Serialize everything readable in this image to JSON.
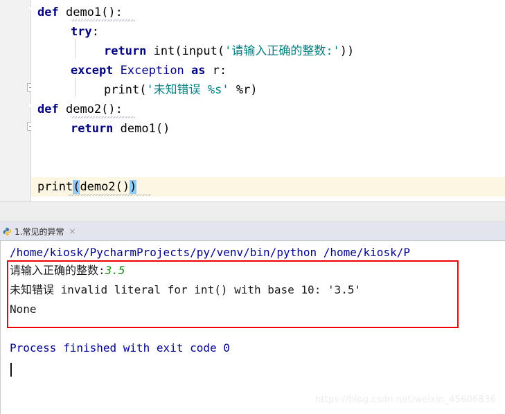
{
  "editor": {
    "lines": [
      {
        "indent": 0,
        "tokens": [
          {
            "t": "def",
            "c": "kw"
          },
          {
            "t": " ",
            "c": "plain"
          },
          {
            "t": "demo1",
            "c": "fn"
          },
          {
            "t": "():",
            "c": "plain"
          }
        ]
      },
      {
        "indent": 1,
        "tokens": [
          {
            "t": "try",
            "c": "kw"
          },
          {
            "t": ":",
            "c": "plain"
          }
        ]
      },
      {
        "indent": 2,
        "tokens": [
          {
            "t": "return",
            "c": "kw"
          },
          {
            "t": " ",
            "c": "plain"
          },
          {
            "t": "int",
            "c": "plain"
          },
          {
            "t": "(",
            "c": "plain"
          },
          {
            "t": "input",
            "c": "plain"
          },
          {
            "t": "(",
            "c": "plain"
          },
          {
            "t": "'请输入正确的整数:'",
            "c": "str"
          },
          {
            "t": "))",
            "c": "plain"
          }
        ]
      },
      {
        "indent": 1,
        "tokens": [
          {
            "t": "except",
            "c": "kw"
          },
          {
            "t": " ",
            "c": "plain"
          },
          {
            "t": "Exception",
            "c": "cls"
          },
          {
            "t": " ",
            "c": "plain"
          },
          {
            "t": "as",
            "c": "kw"
          },
          {
            "t": " ",
            "c": "plain"
          },
          {
            "t": "r:",
            "c": "plain"
          }
        ]
      },
      {
        "indent": 2,
        "tokens": [
          {
            "t": "print",
            "c": "plain"
          },
          {
            "t": "(",
            "c": "plain"
          },
          {
            "t": "'未知错误 %s'",
            "c": "str"
          },
          {
            "t": " %r)",
            "c": "plain"
          }
        ]
      },
      {
        "indent": 0,
        "tokens": [
          {
            "t": "def",
            "c": "kw"
          },
          {
            "t": " ",
            "c": "plain"
          },
          {
            "t": "demo2",
            "c": "fn"
          },
          {
            "t": "():",
            "c": "plain"
          }
        ]
      },
      {
        "indent": 1,
        "tokens": [
          {
            "t": "return",
            "c": "kw"
          },
          {
            "t": " ",
            "c": "plain"
          },
          {
            "t": "demo1()",
            "c": "plain"
          }
        ]
      },
      {
        "indent": 0,
        "tokens": []
      },
      {
        "indent": 0,
        "tokens": []
      },
      {
        "indent": 0,
        "highlight": true,
        "tokens": [
          {
            "t": "print",
            "c": "plain"
          },
          {
            "t": "(",
            "c": "plain brace-hl"
          },
          {
            "t": "demo2()",
            "c": "plain"
          },
          {
            "t": ")",
            "c": "plain brace-hl"
          }
        ]
      }
    ]
  },
  "tabbar": {
    "tab": {
      "icon": "python-file-icon",
      "label": "1.常见的异常",
      "close": "×"
    }
  },
  "console": {
    "command": "/home/kiosk/PycharmProjects/py/venv/bin/python /home/kiosk/P",
    "prompt_text": "请输入正确的整数:",
    "user_input": "3.5",
    "error_prefix": "未知错误 ",
    "error_message": "invalid literal for int() with base 10: '3.5'",
    "return_value": "None",
    "exit_message": "Process finished with exit code 0"
  },
  "annotation": {
    "box_color": "#ef0000"
  },
  "watermark": {
    "text": "https://blog.csdn.net/weixin_45606836"
  },
  "theme": {
    "keyword": "#000080",
    "string": "#008080",
    "console_command": "#00008b",
    "console_input": "#178a17",
    "highlight_line": "#fdf6e3",
    "brace_match": "#93c9f5",
    "gutter": "#f2f2f2",
    "tabbar": "#e2e5ee"
  }
}
